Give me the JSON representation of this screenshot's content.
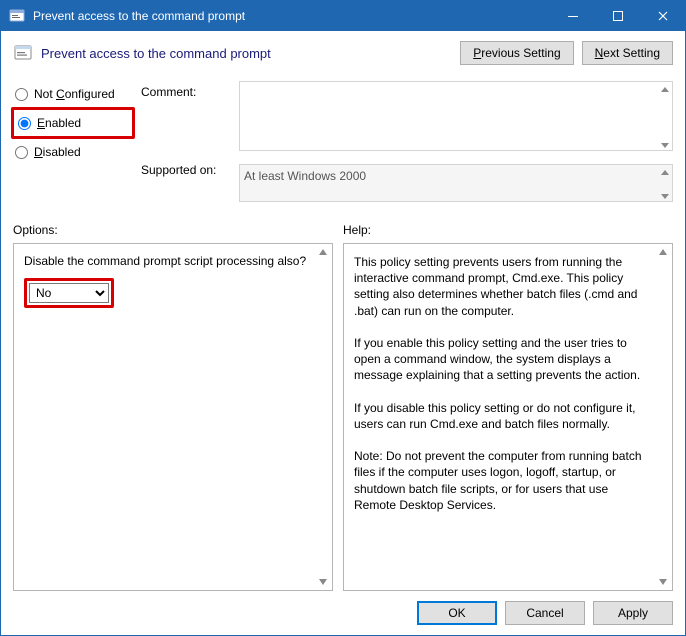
{
  "window": {
    "title": "Prevent access to the command prompt"
  },
  "header": {
    "title": "Prevent access to the command prompt",
    "previous_button_prefix": "P",
    "previous_button_rest": "revious Setting",
    "next_button_prefix": "N",
    "next_button_rest": "ext Setting"
  },
  "state": {
    "not_configured_prefix": "C",
    "not_configured_pre": "Not ",
    "not_configured_rest": "onfigured",
    "enabled_prefix": "E",
    "enabled_rest": "nabled",
    "disabled_prefix": "D",
    "disabled_rest": "isabled",
    "selected": "enabled"
  },
  "labels": {
    "comment": "Comment:",
    "supported_on": "Supported on:",
    "options": "Options:",
    "help": "Help:"
  },
  "supported": {
    "text": "At least Windows 2000"
  },
  "options": {
    "question": "Disable the command prompt script processing also?",
    "dropdown_value": "No"
  },
  "help": {
    "text": "This policy setting prevents users from running the interactive command prompt, Cmd.exe.  This policy setting also determines whether batch files (.cmd and .bat) can run on the computer.\n\nIf you enable this policy setting and the user tries to open a command window, the system displays a message explaining that a setting prevents the action.\n\nIf you disable this policy setting or do not configure it, users can run Cmd.exe and batch files normally.\n\nNote: Do not prevent the computer from running batch files if the computer uses logon, logoff, startup, or shutdown batch file scripts, or for users that use Remote Desktop Services."
  },
  "footer": {
    "ok": "OK",
    "cancel": "Cancel",
    "apply": "Apply"
  }
}
